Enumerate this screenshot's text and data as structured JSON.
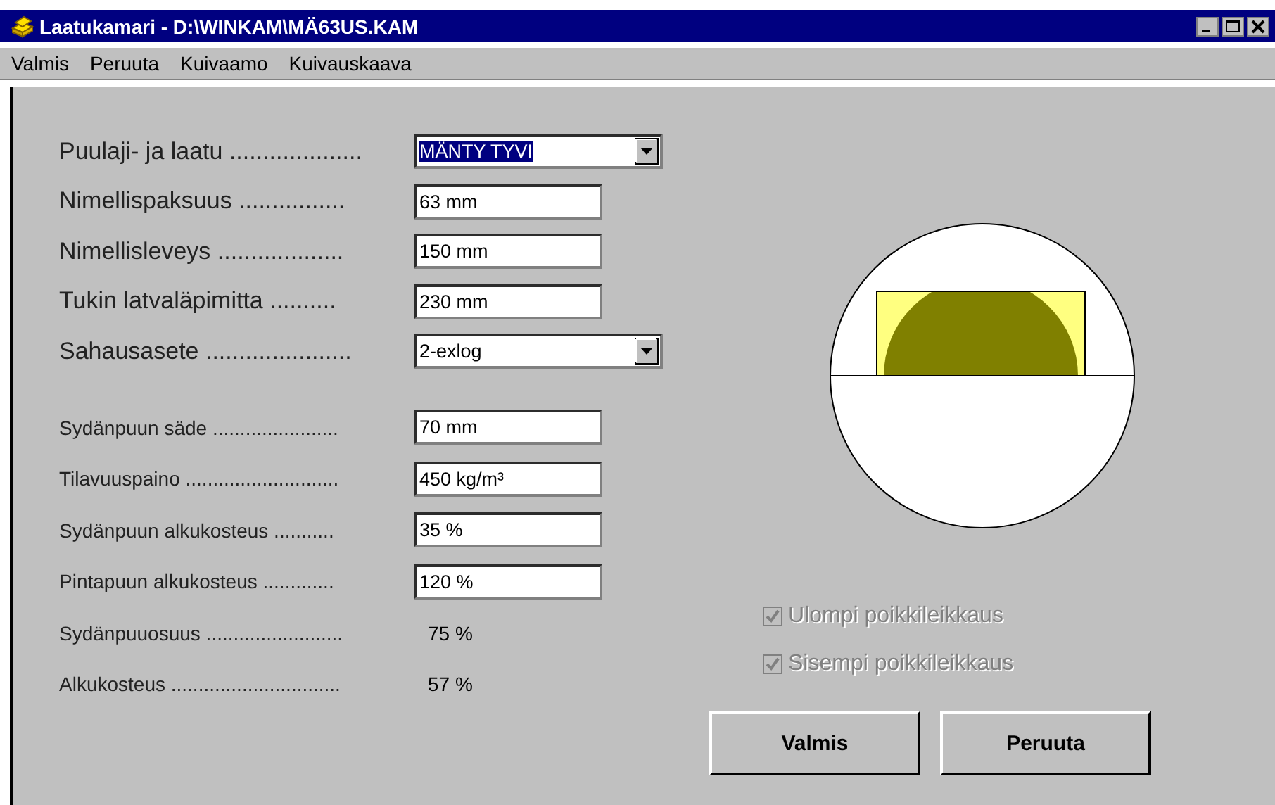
{
  "window": {
    "title": "Laatukamari - D:\\WINKAM\\MÄ63US.KAM"
  },
  "menu": [
    {
      "label": "Valmis"
    },
    {
      "label": "Peruuta"
    },
    {
      "label": "Kuivaamo"
    },
    {
      "label": "Kuivauskaava"
    }
  ],
  "main_fields": [
    {
      "kind": "combo",
      "label": "Puulaji- ja laatu ....................",
      "value": "MÄNTY TYVI",
      "highlighted": true
    },
    {
      "kind": "text",
      "label": "Nimellispaksuus ................",
      "value": "63 mm"
    },
    {
      "kind": "text",
      "label": "Nimellisleveys ...................",
      "value": "150 mm"
    },
    {
      "kind": "text",
      "label": "Tukin latvaläpimitta ..........",
      "value": "230 mm"
    },
    {
      "kind": "combo",
      "label": "Sahausasete ......................",
      "value": "2-exlog",
      "highlighted": false
    }
  ],
  "detail_fields": [
    {
      "kind": "text",
      "label": "Sydänpuun säde .......................",
      "value": "70 mm"
    },
    {
      "kind": "text",
      "label": "Tilavuuspaino ............................",
      "value": "450 kg/m³"
    },
    {
      "kind": "text",
      "label": "Sydänpuun alkukosteus ...........",
      "value": "35 %"
    },
    {
      "kind": "text",
      "label": "Pintapuun alkukosteus .............",
      "value": "120 %"
    },
    {
      "kind": "readout",
      "label": "Sydänpuuosuus .........................",
      "value": "75 %"
    },
    {
      "kind": "readout",
      "label": "Alkukosteus ...............................",
      "value": "57 %"
    }
  ],
  "options": [
    {
      "label": "Ulompi poikkileikkaus",
      "checked": true,
      "disabled": true
    },
    {
      "label": "Sisempi poikkileikkaus",
      "checked": true,
      "disabled": true
    }
  ],
  "buttons": [
    {
      "label": "Valmis"
    },
    {
      "label": "Peruuta"
    }
  ]
}
